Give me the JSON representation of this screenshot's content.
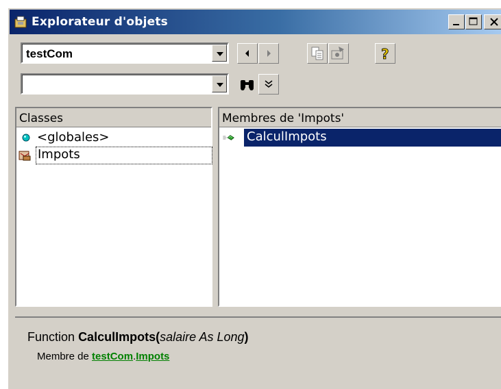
{
  "window": {
    "title": "Explorateur d'objets",
    "buttons": {
      "minimize": "_",
      "maximize": "□",
      "close": "✕"
    }
  },
  "toolbar": {
    "library_combo_value": "testCom",
    "search_combo_value": ""
  },
  "classes": {
    "header": "Classes",
    "items": [
      {
        "label": "<globales>",
        "icon": "globals-dot-icon"
      },
      {
        "label": "Impots",
        "icon": "class-module-icon"
      }
    ]
  },
  "members": {
    "header": "Membres de 'Impots'",
    "items": [
      {
        "label": "CalculImpots",
        "icon": "method-icon"
      }
    ]
  },
  "details": {
    "kind": "Function",
    "name": "CalculImpots",
    "open_paren": "(",
    "params": "salaire As Long",
    "close_paren": ")",
    "member_prefix": "Membre de",
    "library_link": "testCom",
    "dot": ".",
    "class_link": "Impots"
  },
  "colors": {
    "titlebar_start": "#0a246a",
    "selection": "#0a246a",
    "link": "#008000",
    "face": "#d4d0c8"
  }
}
